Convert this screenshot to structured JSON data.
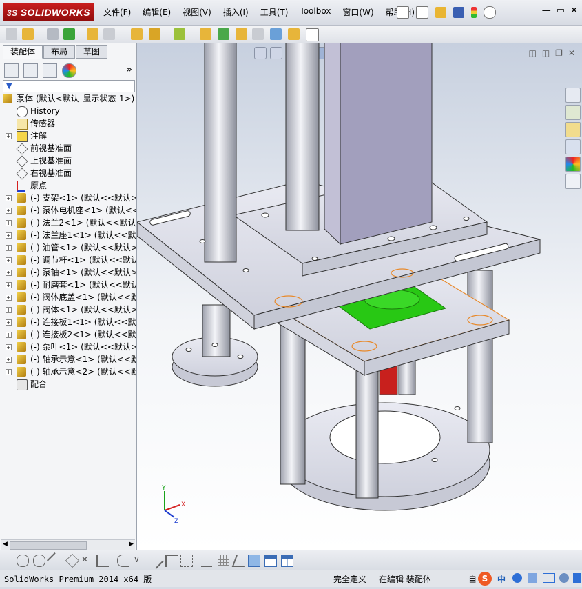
{
  "app": {
    "logo": "SOLIDWORKS",
    "logo_prefix": "3S"
  },
  "menu": [
    "文件(F)",
    "编辑(E)",
    "视图(V)",
    "插入(I)",
    "工具(T)",
    "Toolbox",
    "窗口(W)",
    "帮助(H)"
  ],
  "window_controls": {
    "minimize": "—",
    "restore": "▭",
    "close": "✕"
  },
  "panel_tabs": [
    "装配体",
    "布局",
    "草图"
  ],
  "panel_more": "»",
  "tree": {
    "root": "泵体  (默认<默认_显示状态-1>)",
    "items": [
      {
        "label": "History",
        "icon": "history-icon",
        "expand": ""
      },
      {
        "label": "传感器",
        "icon": "sensor-icon",
        "expand": ""
      },
      {
        "label": "注解",
        "icon": "annotation-icon",
        "expand": "+"
      },
      {
        "label": "前视基准面",
        "icon": "plane-icon",
        "expand": ""
      },
      {
        "label": "上视基准面",
        "icon": "plane-icon",
        "expand": ""
      },
      {
        "label": "右视基准面",
        "icon": "plane-icon",
        "expand": ""
      },
      {
        "label": "原点",
        "icon": "origin-icon",
        "expand": ""
      },
      {
        "label": "(-) 支架<1> (默认<<默认>_",
        "icon": "component-icon",
        "expand": "+"
      },
      {
        "label": "(-) 泵体电机座<1> (默认<<默",
        "icon": "component-icon",
        "expand": "+"
      },
      {
        "label": "(-) 法兰2<1> (默认<<默认>_",
        "icon": "component-icon",
        "expand": "+"
      },
      {
        "label": "(-) 法兰座1<1> (默认<<默认",
        "icon": "component-icon",
        "expand": "+"
      },
      {
        "label": "(-) 油管<1> (默认<<默认>_",
        "icon": "component-icon",
        "expand": "+"
      },
      {
        "label": "(-) 调节杆<1> (默认<<默认>",
        "icon": "component-icon",
        "expand": "+"
      },
      {
        "label": "(-) 泵轴<1> (默认<<默认>_",
        "icon": "component-icon",
        "expand": "+"
      },
      {
        "label": "(-) 耐磨套<1> (默认<<默认>",
        "icon": "component-icon",
        "expand": "+"
      },
      {
        "label": "(-) 阀体底盖<1> (默认<<默认",
        "icon": "component-icon",
        "expand": "+"
      },
      {
        "label": "(-) 阀体<1> (默认<<默认>_",
        "icon": "component-icon",
        "expand": "+"
      },
      {
        "label": "(-) 连接板1<1> (默认<<默认",
        "icon": "component-icon",
        "expand": "+"
      },
      {
        "label": "(-) 连接板2<1> (默认<<默认",
        "icon": "component-icon",
        "expand": "+"
      },
      {
        "label": "(-) 泵叶<1> (默认<<默认>_",
        "icon": "component-icon",
        "expand": "+"
      },
      {
        "label": "(-) 轴承示意<1> (默认<<默",
        "icon": "component-icon",
        "expand": "+"
      },
      {
        "label": "(-) 轴承示意<2> (默认<<默",
        "icon": "component-icon",
        "expand": "+"
      },
      {
        "label": "配合",
        "icon": "mates-icon",
        "expand": ""
      }
    ]
  },
  "triad": {
    "x": "X",
    "y": "Y",
    "z": "Z"
  },
  "status": {
    "product": "SolidWorks Premium 2014 x64 版",
    "state": "完全定义",
    "mode": "在编辑 装配体",
    "ime": "自"
  },
  "colors": {
    "accent_red": "#c8201d",
    "selection_orange": "#e8892a",
    "highlight_green": "#28c814",
    "part_metal": "#d8dbe6"
  }
}
